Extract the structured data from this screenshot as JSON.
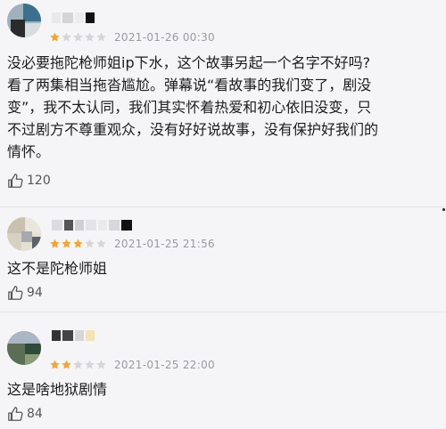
{
  "comments": [
    {
      "rating": 1,
      "time": "2021-01-26 00:30",
      "lines": [
        "没必要拖陀枪师姐ip下水，这个故事另起一个名字不好吗?",
        "看了两集相当拖沓尴尬。弹幕说“看故事的我们变了，剧没",
        "变”，我不太认同，我们其实怀着热爱和初心依旧没变，只",
        "不过剧方不尊重观众，没有好好说故事，没有保护好我们的",
        "情怀。"
      ],
      "likes": "120"
    },
    {
      "rating": 3,
      "time": "2021-01-25 21:56",
      "lines": [
        "这不是陀枪师姐"
      ],
      "likes": "94"
    },
    {
      "rating": 2,
      "time": "2021-01-25 22:00",
      "lines": [
        "这是啥地狱剧情"
      ],
      "likes": "84"
    }
  ],
  "colors": {
    "star_filled": "#f0a53a",
    "star_empty": "#d6d6da",
    "text": "#1c1c1e",
    "meta": "#9a9aa0"
  },
  "icons": {
    "like": "thumbs-up-icon",
    "star": "star-icon"
  }
}
